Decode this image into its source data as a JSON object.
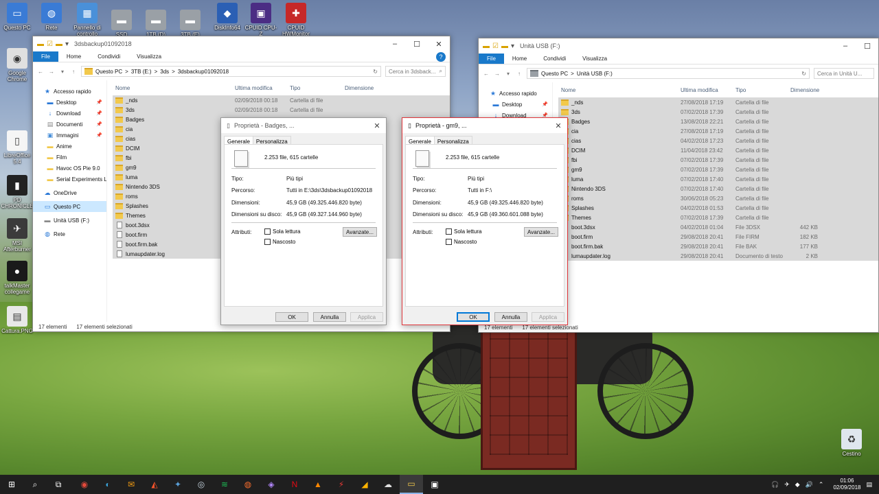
{
  "desktop_icons": [
    {
      "label": "Questo PC",
      "color": "#3a7bd5",
      "glyph": "▭"
    },
    {
      "label": "Rete",
      "color": "#3a7bd5",
      "glyph": "◍"
    },
    {
      "label": "Pannello di controllo",
      "color": "#4a90d9",
      "glyph": "▦"
    },
    {
      "label": "SSD",
      "color": "#9aa0a6",
      "glyph": "▬"
    },
    {
      "label": "1TB (D)",
      "color": "#9aa0a6",
      "glyph": "▬"
    },
    {
      "label": "3TB (E)",
      "color": "#9aa0a6",
      "glyph": "▬"
    },
    {
      "label": "DiskInfo64",
      "color": "#2b5fb4",
      "glyph": "◆"
    },
    {
      "label": "CPUID CPU-Z",
      "color": "#4b2d84",
      "glyph": "▣"
    },
    {
      "label": "CPUID HWMonitor",
      "color": "#c62828",
      "glyph": "✚"
    },
    {
      "label": "Google Chrome",
      "color": "#e0e0e0",
      "glyph": "◉"
    },
    {
      "label": "LibreOffice 5.4",
      "color": "#f5f5f5",
      "glyph": "▯"
    },
    {
      "label": "PD CHRONICLE",
      "color": "#222222",
      "glyph": "▮"
    },
    {
      "label": "MSI Afterburner",
      "color": "#3b3b3b",
      "glyph": "✈"
    },
    {
      "label": "talkMaster collegame",
      "color": "#1a1a1a",
      "glyph": "●"
    },
    {
      "label": "Cattura.PNG",
      "color": "#e8e8e8",
      "glyph": "▤"
    },
    {
      "label": "Cestino",
      "color": "#dfe6ee",
      "glyph": "♻"
    }
  ],
  "left_window": {
    "title": "3dsbackup01092018",
    "ribbon_tabs": [
      "File",
      "Home",
      "Condividi",
      "Visualizza"
    ],
    "address_parts": [
      "Questo PC",
      ">",
      "3TB (E:)",
      ">",
      "3ds",
      ">",
      "3dsbackup01092018"
    ],
    "search_placeholder": "Cerca in 3dsback...",
    "nav": [
      {
        "label": "Accesso rapido",
        "icon": "star-icon",
        "pinned": false,
        "sub": false
      },
      {
        "label": "Desktop",
        "icon": "desktop-icon",
        "pinned": true,
        "sub": true
      },
      {
        "label": "Download",
        "icon": "download-icon",
        "pinned": true,
        "sub": true
      },
      {
        "label": "Documenti",
        "icon": "documents-icon",
        "pinned": true,
        "sub": true
      },
      {
        "label": "Immagini",
        "icon": "pictures-icon",
        "pinned": true,
        "sub": true
      },
      {
        "label": "Anime",
        "icon": "folder-icon",
        "pinned": false,
        "sub": true
      },
      {
        "label": "Film",
        "icon": "folder-icon",
        "pinned": false,
        "sub": true
      },
      {
        "label": "Havoc OS Pie 9.0",
        "icon": "folder-icon",
        "pinned": false,
        "sub": true
      },
      {
        "label": "Serial Experiments L",
        "icon": "folder-icon",
        "pinned": false,
        "sub": true
      },
      {
        "label": "OneDrive",
        "icon": "cloud-icon",
        "pinned": false,
        "sub": false
      },
      {
        "label": "Questo PC",
        "icon": "pc-icon",
        "pinned": false,
        "sub": false
      },
      {
        "label": "Unità USB (F:)",
        "icon": "usb-drive-icon",
        "pinned": false,
        "sub": false
      },
      {
        "label": "Rete",
        "icon": "network-icon",
        "pinned": false,
        "sub": false
      }
    ],
    "columns": [
      "Nome",
      "Ultima modifica",
      "Tipo",
      "Dimensione"
    ],
    "rows": [
      {
        "name": "_nds",
        "date": "02/09/2018 00:18",
        "type": "Cartella di file",
        "size": "",
        "folder": true
      },
      {
        "name": "3ds",
        "date": "02/09/2018 00:18",
        "type": "Cartella di file",
        "size": "",
        "folder": true
      },
      {
        "name": "Badges",
        "date": "02/09/2018 00:18",
        "type": "Cartella di file",
        "size": "",
        "folder": true
      },
      {
        "name": "cia",
        "date": "",
        "type": "",
        "size": "",
        "folder": true
      },
      {
        "name": "cias",
        "date": "",
        "type": "",
        "size": "",
        "folder": true
      },
      {
        "name": "DCIM",
        "date": "",
        "type": "",
        "size": "",
        "folder": true
      },
      {
        "name": "fbi",
        "date": "",
        "type": "",
        "size": "",
        "folder": true
      },
      {
        "name": "gm9",
        "date": "",
        "type": "",
        "size": "",
        "folder": true
      },
      {
        "name": "luma",
        "date": "",
        "type": "",
        "size": "",
        "folder": true
      },
      {
        "name": "Nintendo 3DS",
        "date": "",
        "type": "",
        "size": "",
        "folder": true
      },
      {
        "name": "roms",
        "date": "",
        "type": "",
        "size": "",
        "folder": true
      },
      {
        "name": "Splashes",
        "date": "",
        "type": "",
        "size": "",
        "folder": true
      },
      {
        "name": "Themes",
        "date": "",
        "type": "",
        "size": "",
        "folder": true
      },
      {
        "name": "boot.3dsx",
        "date": "",
        "type": "",
        "size": "",
        "folder": false
      },
      {
        "name": "boot.firm",
        "date": "",
        "type": "",
        "size": "",
        "folder": false
      },
      {
        "name": "boot.firm.bak",
        "date": "",
        "type": "",
        "size": "",
        "folder": false
      },
      {
        "name": "lumaupdater.log",
        "date": "",
        "type": "",
        "size": "",
        "folder": false
      }
    ],
    "status_count": "17 elementi",
    "status_selected": "17 elementi selezionati"
  },
  "right_window": {
    "title": "Unità USB (F:)",
    "ribbon_tabs": [
      "File",
      "Home",
      "Condividi",
      "Visualizza"
    ],
    "address_parts": [
      "Questo PC",
      ">",
      "Unità USB (F:)"
    ],
    "search_placeholder": "Cerca in Unità U...",
    "nav": [
      {
        "label": "Accesso rapido",
        "icon": "star-icon",
        "pinned": false,
        "sub": false
      },
      {
        "label": "Desktop",
        "icon": "desktop-icon",
        "pinned": true,
        "sub": true
      },
      {
        "label": "Download",
        "icon": "download-icon",
        "pinned": true,
        "sub": true
      }
    ],
    "columns": [
      "Nome",
      "Ultima modifica",
      "Tipo",
      "Dimensione"
    ],
    "rows": [
      {
        "name": "_nds",
        "date": "27/08/2018 17:19",
        "type": "Cartella di file",
        "size": "",
        "folder": true
      },
      {
        "name": "3ds",
        "date": "07/02/2018 17:39",
        "type": "Cartella di file",
        "size": "",
        "folder": true
      },
      {
        "name": "Badges",
        "date": "13/08/2018 22:21",
        "type": "Cartella di file",
        "size": "",
        "folder": true
      },
      {
        "name": "cia",
        "date": "27/08/2018 17:19",
        "type": "Cartella di file",
        "size": "",
        "folder": true
      },
      {
        "name": "cias",
        "date": "04/02/2018 17:23",
        "type": "Cartella di file",
        "size": "",
        "folder": true
      },
      {
        "name": "DCIM",
        "date": "11/04/2018 23:42",
        "type": "Cartella di file",
        "size": "",
        "folder": true
      },
      {
        "name": "fbi",
        "date": "07/02/2018 17:39",
        "type": "Cartella di file",
        "size": "",
        "folder": true
      },
      {
        "name": "gm9",
        "date": "07/02/2018 17:39",
        "type": "Cartella di file",
        "size": "",
        "folder": true
      },
      {
        "name": "luma",
        "date": "07/02/2018 17:40",
        "type": "Cartella di file",
        "size": "",
        "folder": true
      },
      {
        "name": "Nintendo 3DS",
        "date": "07/02/2018 17:40",
        "type": "Cartella di file",
        "size": "",
        "folder": true
      },
      {
        "name": "roms",
        "date": "30/06/2018 05:23",
        "type": "Cartella di file",
        "size": "",
        "folder": true
      },
      {
        "name": "Splashes",
        "date": "04/02/2018 01:53",
        "type": "Cartella di file",
        "size": "",
        "folder": true
      },
      {
        "name": "Themes",
        "date": "07/02/2018 17:39",
        "type": "Cartella di file",
        "size": "",
        "folder": true
      },
      {
        "name": "boot.3dsx",
        "date": "04/02/2018 01:04",
        "type": "File 3DSX",
        "size": "442 KB",
        "folder": false
      },
      {
        "name": "boot.firm",
        "date": "29/08/2018 20:41",
        "type": "File FIRM",
        "size": "182 KB",
        "folder": false
      },
      {
        "name": "boot.firm.bak",
        "date": "29/08/2018 20:41",
        "type": "File BAK",
        "size": "177 KB",
        "folder": false
      },
      {
        "name": "lumaupdater.log",
        "date": "29/08/2018 20:41",
        "type": "Documento di testo",
        "size": "2 KB",
        "folder": false
      }
    ],
    "status_count": "17 elementi",
    "status_selected": "17 elementi selezionati"
  },
  "dialog_left": {
    "title": "Proprietà - Badges, ...",
    "tabs": [
      "Generale",
      "Personalizza"
    ],
    "summary": "2.253 file, 615 cartelle",
    "type_label": "Tipo:",
    "type_value": "Più tipi",
    "path_label": "Percorso:",
    "path_value": "Tutti in E:\\3ds\\3dsbackup01092018",
    "size_label": "Dimensioni:",
    "size_value": "45,9 GB (49.325.446.820 byte)",
    "disk_label": "Dimensioni su disco:",
    "disk_value": "45,9 GB (49.327.144.960 byte)",
    "attr_label": "Attributi:",
    "readonly": "Sola lettura",
    "hidden": "Nascosto",
    "advanced": "Avanzate...",
    "ok": "OK",
    "cancel": "Annulla",
    "apply": "Applica"
  },
  "dialog_right": {
    "title": "Proprietà - gm9, ...",
    "tabs": [
      "Generale",
      "Personalizza"
    ],
    "summary": "2.253 file, 615 cartelle",
    "type_label": "Tipo:",
    "type_value": "Più tipi",
    "path_label": "Percorso:",
    "path_value": "Tutti in F:\\",
    "size_label": "Dimensioni:",
    "size_value": "45,9 GB (49.325.446.820 byte)",
    "disk_label": "Dimensioni su disco:",
    "disk_value": "45,9 GB (49.360.601.088 byte)",
    "attr_label": "Attributi:",
    "readonly": "Sola lettura",
    "hidden": "Nascosto",
    "advanced": "Avanzate...",
    "ok": "OK",
    "cancel": "Annulla",
    "apply": "Applica"
  },
  "taskbar": {
    "apps": [
      {
        "name": "start-icon",
        "glyph": "⊞",
        "color": "#ffffff",
        "active": false
      },
      {
        "name": "search-icon",
        "glyph": "⌕",
        "color": "#ffffff",
        "active": false
      },
      {
        "name": "task-view-icon",
        "glyph": "⧉",
        "color": "#ffffff",
        "active": false
      },
      {
        "name": "chrome-icon",
        "glyph": "◉",
        "color": "#e24a3b",
        "active": false
      },
      {
        "name": "headphones-app-icon",
        "glyph": "◐",
        "color": "#39a0d6",
        "active": false
      },
      {
        "name": "messenger-app-icon",
        "glyph": "✉",
        "color": "#f39c12",
        "active": false
      },
      {
        "name": "brave-icon",
        "glyph": "◭",
        "color": "#fb542b",
        "active": false
      },
      {
        "name": "game-app-icon",
        "glyph": "✦",
        "color": "#5aa0d8",
        "active": false
      },
      {
        "name": "steam-icon",
        "glyph": "◎",
        "color": "#c7d5e0",
        "active": false
      },
      {
        "name": "spotify-icon",
        "glyph": "≋",
        "color": "#1db954",
        "active": false
      },
      {
        "name": "origin-icon",
        "glyph": "◍",
        "color": "#f56c2d",
        "active": false
      },
      {
        "name": "app-purple-icon",
        "glyph": "◈",
        "color": "#b388ff",
        "active": false
      },
      {
        "name": "netflix-icon",
        "glyph": "N",
        "color": "#e50914",
        "active": false
      },
      {
        "name": "vlc-icon",
        "glyph": "▲",
        "color": "#ff8800",
        "active": false
      },
      {
        "name": "flash-app-icon",
        "glyph": "⚡",
        "color": "#e53935",
        "active": false
      },
      {
        "name": "bird-app-icon",
        "glyph": "◢",
        "color": "#ffb300",
        "active": false
      },
      {
        "name": "cloud-app-icon",
        "glyph": "☁",
        "color": "#e0e0e0",
        "active": false
      },
      {
        "name": "file-explorer-icon",
        "glyph": "▭",
        "color": "#f2c94c",
        "active": true
      },
      {
        "name": "photos-icon",
        "glyph": "▣",
        "color": "#ffffff",
        "active": false
      }
    ],
    "time": "01:06",
    "date": "02/09/2018"
  }
}
